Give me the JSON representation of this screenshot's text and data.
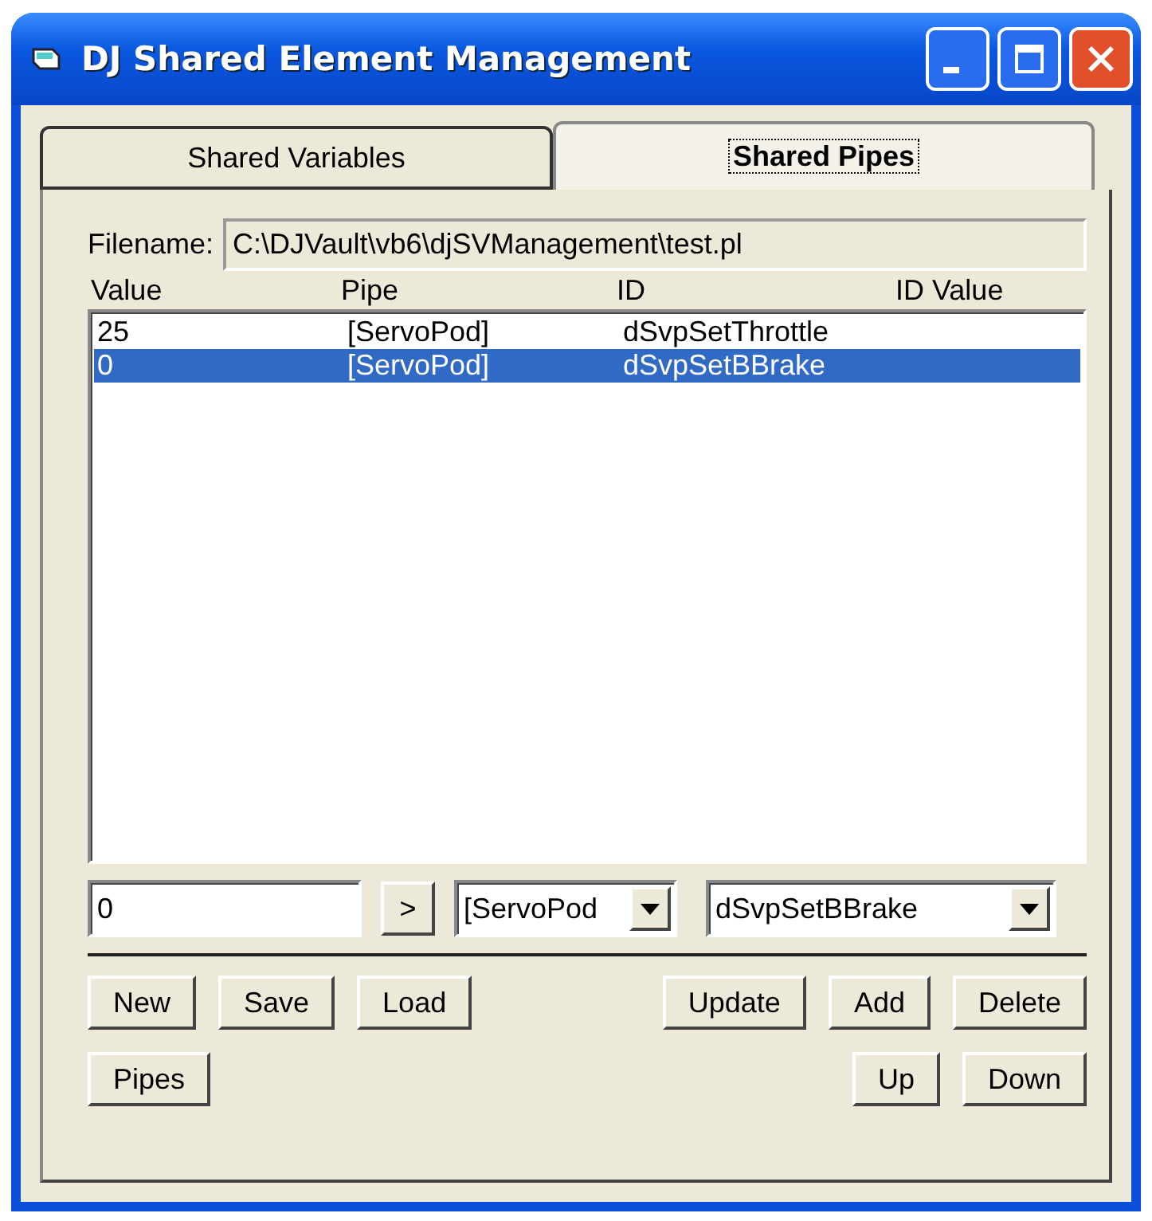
{
  "window": {
    "title": "DJ Shared Element Management"
  },
  "tabs": [
    {
      "label": "Shared Variables",
      "selected": false
    },
    {
      "label": "Shared Pipes",
      "selected": true
    }
  ],
  "filename": {
    "label": "Filename:",
    "value": "C:\\DJVault\\vb6\\djSVManagement\\test.pl"
  },
  "list": {
    "columns": [
      "Value",
      "Pipe",
      "ID",
      "ID Value"
    ],
    "rows": [
      {
        "cells": [
          "25",
          "[ServoPod]",
          "dSvpSetThrottle"
        ],
        "selected": false
      },
      {
        "cells": [
          "0",
          "[ServoPod]",
          "dSvpSetBBrake"
        ],
        "selected": true
      }
    ]
  },
  "editor": {
    "value_field": "0",
    "arrow_button": ">",
    "pipe_combo": "[ServoPod",
    "id_combo": "dSvpSetBBrake"
  },
  "button_rows": [
    {
      "left": [
        "New",
        "Save",
        "Load"
      ],
      "right": [
        "Update",
        "Add",
        "Delete"
      ]
    },
    {
      "left": [
        "Pipes"
      ],
      "right": [
        "Up",
        "Down"
      ]
    }
  ]
}
